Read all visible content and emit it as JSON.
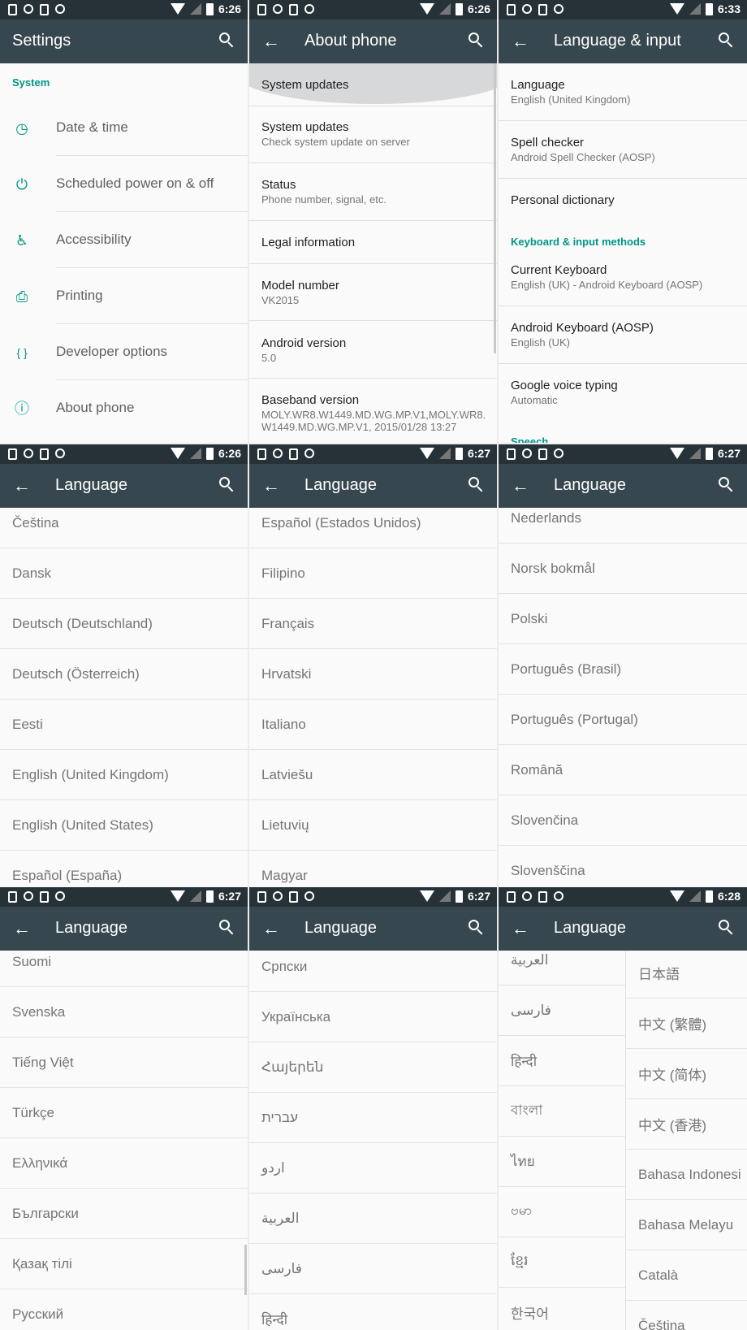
{
  "panels": {
    "settings": {
      "time": "6:26",
      "title": "Settings",
      "section": "System",
      "items": [
        {
          "label": "Date & time",
          "icon": "clock-icon"
        },
        {
          "label": "Scheduled power on & off",
          "icon": "power-clock-icon"
        },
        {
          "label": "Accessibility",
          "icon": "accessibility-icon"
        },
        {
          "label": "Printing",
          "icon": "printer-icon"
        },
        {
          "label": "Developer options",
          "icon": "braces-icon"
        },
        {
          "label": "About phone",
          "icon": "info-icon"
        }
      ]
    },
    "about": {
      "time": "6:26",
      "title": "About phone",
      "items": [
        {
          "title": "System updates",
          "sub": ""
        },
        {
          "title": "System updates",
          "sub": "Check system update on server"
        },
        {
          "title": "Status",
          "sub": "Phone number, signal, etc."
        },
        {
          "title": "Legal information",
          "sub": ""
        },
        {
          "title": "Model number",
          "sub": "VK2015"
        },
        {
          "title": "Android version",
          "sub": "5.0"
        },
        {
          "title": "Baseband version",
          "sub": "MOLY.WR8.W1449.MD.WG.MP.V1,MOLY.WR8.",
          "sub2": "W1449.MD.WG.MP.V1, 2015/01/28 13:27"
        }
      ]
    },
    "language_input": {
      "time": "6:33",
      "title": "Language & input",
      "items": [
        {
          "title": "Language",
          "sub": "English (United Kingdom)"
        },
        {
          "title": "Spell checker",
          "sub": "Android Spell Checker (AOSP)"
        },
        {
          "title": "Personal dictionary",
          "sub": ""
        }
      ],
      "section": "Keyboard & input methods",
      "keyboard_items": [
        {
          "title": "Current Keyboard",
          "sub": "English (UK) - Android Keyboard (AOSP)"
        },
        {
          "title": "Android Keyboard (AOSP)",
          "sub": "English (UK)"
        },
        {
          "title": "Google voice typing",
          "sub": "Automatic"
        }
      ],
      "section2": "Speech"
    },
    "lang1": {
      "time": "6:26",
      "title": "Language",
      "items": [
        "Čeština",
        "Dansk",
        "Deutsch (Deutschland)",
        "Deutsch (Österreich)",
        "Eesti",
        "English (United Kingdom)",
        "English (United States)",
        "Español (España)"
      ]
    },
    "lang2": {
      "time": "6:27",
      "title": "Language",
      "items": [
        "Español (Estados Unidos)",
        "Filipino",
        "Français",
        "Hrvatski",
        "Italiano",
        "Latviešu",
        "Lietuvių",
        "Magyar"
      ]
    },
    "lang3": {
      "time": "6:27",
      "title": "Language",
      "items": [
        "Nederlands",
        "Norsk bokmål",
        "Polski",
        "Português (Brasil)",
        "Português (Portugal)",
        "Română",
        "Slovenčina",
        "Slovenščina"
      ]
    },
    "lang4": {
      "time": "6:27",
      "title": "Language",
      "items": [
        "Suomi",
        "Svenska",
        "Tiếng Việt",
        "Türkçe",
        "Ελληνικά",
        "Български",
        "Қазақ тілі",
        "Русский"
      ]
    },
    "lang5": {
      "time": "6:27",
      "title": "Language",
      "items": [
        "Српски",
        "Українська",
        "Հայերեն",
        "עברית",
        "اردو",
        "العربية",
        "فارسی",
        "हिन्दी"
      ]
    },
    "lang6": {
      "time": "6:28",
      "title": "Language",
      "left_items": [
        "العربية",
        "فارسی",
        "हिन्दी",
        "বাংলা",
        "ไทย",
        "ဗမာ",
        "ខ្មែរ",
        "한국어"
      ],
      "right_items": [
        "日本語",
        "中文 (繁體)",
        "中文 (简体)",
        "中文 (香港)",
        "Bahasa Indonesi",
        "Bahasa Melayu",
        "Català",
        "Čeština"
      ]
    }
  },
  "colors": {
    "statusbar": "#263238",
    "appbar": "#37474f",
    "accent": "#009688"
  }
}
